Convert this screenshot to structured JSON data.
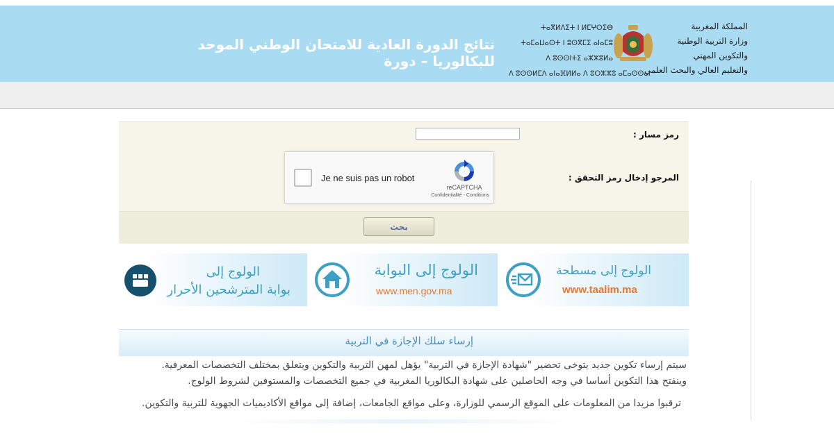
{
  "header": {
    "title": "نتائج الدورة العادية للامتحان الوطني الموحد للبكالوريا – دورة",
    "tifinagh_lines": [
      "ⵜⴰⴳⵍⴷⵉⵜ ⵏ ⵍⵎⵖⵔⵉⴱ",
      "ⵜⴰⵎⴰⵡⴰⵙⵜ ⵏ ⵓⵙⴳⵎⵉ ⴰⵏⴰⵎⵓ",
      "ⴷ ⵓⵙⵙⵏⵜⵉ ⴰⵣⵣⵓⵍⴰ",
      "ⴷ ⵓⵙⵙⵍⵎⴷ ⴰⵏⴰⴼⵍⵍⴰ ⴷ ⵓⵔⵣⵣⵓ ⴰⵎⴰⵙⵙⴰⵏ"
    ],
    "ministry_lines": [
      "المملكة المغربية",
      "وزارة التربية الوطنية",
      "والتكوين المهني",
      "والتعليم العالي والبحث العلمي"
    ]
  },
  "form": {
    "massar_label": "رمز مسار :",
    "massar_value": "",
    "captcha_label": "المرجو إدخال رمز التحقق :",
    "captcha": {
      "text": "Je ne suis pas un robot",
      "brand": "reCAPTCHA",
      "links": "Confidentialité - Conditions"
    },
    "search_button": "بحث"
  },
  "banners": [
    {
      "line1": "الولوج إلى مسطحة",
      "line2": "www.taalim.ma",
      "line2_color": "#e8772e"
    },
    {
      "line1": "الولوج إلى البوابة",
      "line2": "www.men.gov.ma",
      "line2_color": "#e8772e"
    },
    {
      "line1": "الولوج إلى",
      "line2": "بوابة المترشحين الأحرار",
      "line2_color": "#3d9fc4"
    }
  ],
  "section": {
    "title": "إرساء سلك الإجازة في التربية",
    "paragraph1_line1": "سيتم إرساء تكوين جديد يتوخى تحضير \"شهادة الإجازة في التربية\" يؤهل لمهن التربية والتكوين ويتعلق بمختلف التخصصات المعرفية.",
    "paragraph1_line2": "وينفتح هذا التكوين أساسا في وجه الحاصلين على شهادة البكالوريا المغربية في جميع التخصصات والمستوفين لشروط الولوج.",
    "paragraph2": "ترقبوا مزيدا من المعلومات على الموقع الرسمي للوزارة، وعلى مواقع الجامعات، إضافة إلى مواقع الأكاديميات الجهوية للتربية والتكوين."
  },
  "colors": {
    "header_bg": "#a9dcf3",
    "banner_blue": "#3d9fc4",
    "banner_orange": "#e8772e",
    "form_bg": "#f6f5e9"
  }
}
